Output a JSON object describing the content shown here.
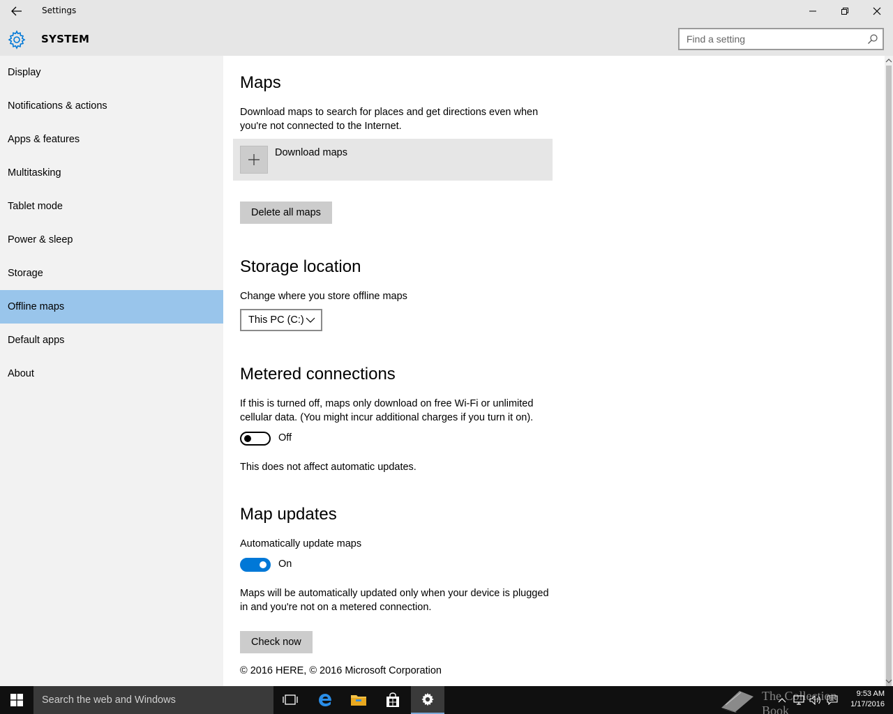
{
  "window": {
    "title": "Settings"
  },
  "header": {
    "section": "SYSTEM",
    "search_placeholder": "Find a setting"
  },
  "sidebar": {
    "items": [
      {
        "label": "Display"
      },
      {
        "label": "Notifications & actions"
      },
      {
        "label": "Apps & features"
      },
      {
        "label": "Multitasking"
      },
      {
        "label": "Tablet mode"
      },
      {
        "label": "Power & sleep"
      },
      {
        "label": "Storage"
      },
      {
        "label": "Offline maps"
      },
      {
        "label": "Default apps"
      },
      {
        "label": "About"
      }
    ],
    "selected": "Offline maps"
  },
  "main": {
    "maps_heading": "Maps",
    "maps_desc": "Download maps to search for places and get directions even when you're not connected to the Internet.",
    "download_label": "Download maps",
    "delete_label": "Delete all maps",
    "storage_heading": "Storage location",
    "storage_desc": "Change where you store offline maps",
    "storage_value": "This PC (C:)",
    "metered_heading": "Metered connections",
    "metered_desc": "If this is turned off, maps only download on free Wi-Fi or unlimited cellular data. (You might incur additional charges if you turn it on).",
    "metered_state": "Off",
    "metered_note": "This does not affect automatic updates.",
    "updates_heading": "Map updates",
    "updates_desc": "Automatically update maps",
    "updates_state": "On",
    "updates_note": "Maps will be automatically updated only when your device is plugged in and you're not on a metered connection.",
    "check_label": "Check now",
    "copyright": "© 2016 HERE, © 2016 Microsoft Corporation"
  },
  "taskbar": {
    "search_placeholder": "Search the web and Windows",
    "time": "9:53 AM",
    "date": "1/17/2016",
    "watermark": "The Collection Book"
  },
  "colors": {
    "accent": "#0078d7",
    "selected_item": "#99c5eb",
    "chrome": "#e6e6e6"
  },
  "icons": [
    "back-arrow-icon",
    "minimize-icon",
    "maximize-icon",
    "close-icon",
    "gear-icon",
    "search-icon",
    "plus-icon",
    "chevron-down-icon",
    "windows-start-icon",
    "task-view-icon",
    "edge-icon",
    "file-explorer-icon",
    "store-icon",
    "settings-gear-icon",
    "tray-chevron-icon",
    "network-icon",
    "volume-icon",
    "action-center-icon"
  ]
}
